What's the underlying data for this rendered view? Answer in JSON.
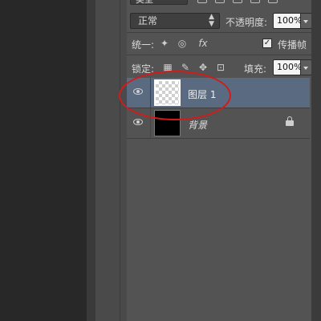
{
  "filter_row": {
    "kind_label": "类型"
  },
  "blend": {
    "mode": "正常",
    "opacity_label": "不透明度:",
    "opacity_value": "100%"
  },
  "unify": {
    "label": "统一:",
    "propagate_label": "传播帧",
    "propagate_checked": true
  },
  "lock": {
    "label": "锁定:",
    "fill_label": "填充:",
    "fill_value": "100%"
  },
  "layers": [
    {
      "name": "图层 1",
      "visible": true,
      "selected": true,
      "thumbnail": "transparent-checker"
    },
    {
      "name": "背景",
      "visible": true,
      "selected": false,
      "locked": true,
      "thumbnail": "black"
    }
  ],
  "annotation": {
    "highlight_color": "#d21b1b"
  },
  "colors": {
    "panel_bg": "#535353",
    "selected_row": "#5a6a80"
  }
}
